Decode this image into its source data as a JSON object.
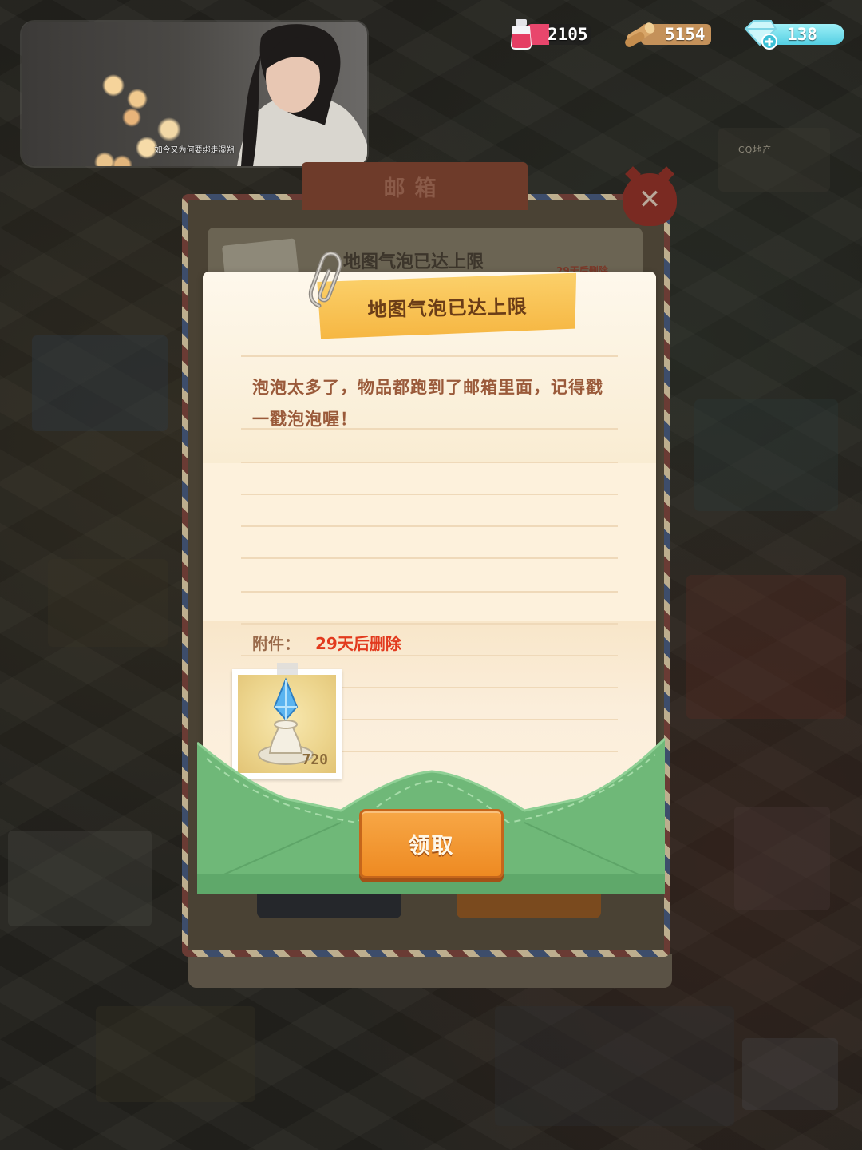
{
  "video": {
    "subtitle": "如今又为何要绑走湿朔"
  },
  "currencies": [
    {
      "name": "ink",
      "value": "2105",
      "icon": "ink-bottle-icon",
      "color": "#e8466c"
    },
    {
      "name": "wood",
      "value": "5154",
      "icon": "wood-log-icon",
      "color": "#c4915a"
    },
    {
      "name": "gem",
      "value": "138",
      "icon": "diamond-plus-icon",
      "color": "#54cfe3"
    }
  ],
  "background": {
    "world_label": "CQ地产"
  },
  "mailbox": {
    "title": "邮箱",
    "back_item_title": "地图气泡已达上限",
    "back_item_meta": "29天后删除"
  },
  "letter": {
    "title": "地图气泡已达上限",
    "body": "泡泡太多了，物品都跑到了邮箱里面，记得戳一戳泡泡喔！",
    "attachment_label": "附件：",
    "attachment_expire": "29天后删除",
    "attachment_item": {
      "icon": "crystal-pedestal-icon",
      "count": "720"
    },
    "claim_label": "领取"
  }
}
